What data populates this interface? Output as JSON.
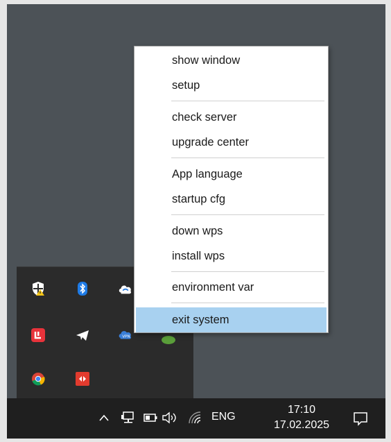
{
  "context_menu": {
    "items": [
      {
        "label": "show window"
      },
      {
        "label": "setup"
      },
      {
        "label": "check server"
      },
      {
        "label": "upgrade center"
      },
      {
        "label": "App language"
      },
      {
        "label": "startup cfg"
      },
      {
        "label": "down wps"
      },
      {
        "label": "install wps"
      },
      {
        "label": "environment var"
      },
      {
        "label": "exit system",
        "highlighted": true
      }
    ],
    "highlight_color": "#a8d1f0"
  },
  "tray_overflow": {
    "icons": [
      "windows-security-icon",
      "bluetooth-icon",
      "cloud-sync-icon",
      "red-app-icon",
      "telegram-icon",
      "network-app-icon",
      "green-app-icon",
      "chrome-icon",
      "red-remote-icon"
    ]
  },
  "taskbar": {
    "language": "ENG",
    "time": "17:10",
    "date": "17.02.2025",
    "icons": [
      "show-hidden-icons-chevron",
      "network-icon",
      "battery-icon",
      "volume-icon",
      "wifi-icon",
      "notification-icon"
    ]
  },
  "colors": {
    "desktop": "#4c5257",
    "taskbar": "#1f1f1f",
    "tray_panel": "#2b2b2b"
  }
}
